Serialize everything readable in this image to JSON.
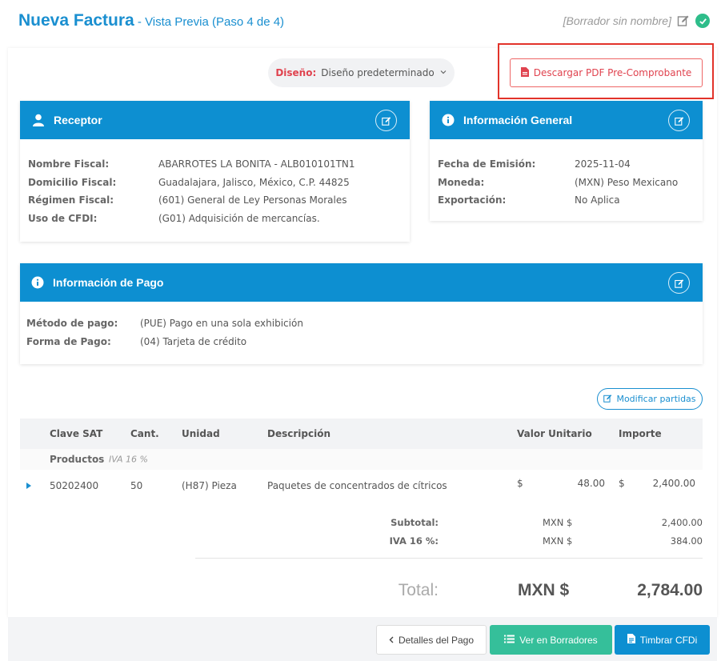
{
  "header": {
    "title": "Nueva Factura",
    "subtitle": " - Vista Previa (Paso 4 de 4)",
    "draft_name": "[Borrador sin nombre]"
  },
  "design": {
    "label": "Diseño:",
    "value": "Diseño predeterminado"
  },
  "pdf_button": {
    "label": "Descargar PDF Pre-Comprobante"
  },
  "receptor": {
    "title": "Receptor",
    "rows": [
      {
        "k": "Nombre Fiscal:",
        "v": "ABARROTES LA BONITA - ALB010101TN1"
      },
      {
        "k": "Domicilio Fiscal:",
        "v": "Guadalajara, Jalisco, México, C.P. 44825"
      },
      {
        "k": "Régimen Fiscal:",
        "v": "(601) General de Ley Personas Morales"
      },
      {
        "k": "Uso de CFDI:",
        "v": "(G01) Adquisición de mercancías."
      }
    ]
  },
  "general": {
    "title": "Información General",
    "rows": [
      {
        "k": "Fecha de Emisión:",
        "v": "2025-11-04"
      },
      {
        "k": "Moneda:",
        "v": "(MXN) Peso Mexicano"
      },
      {
        "k": "Exportación:",
        "v": "No Aplica"
      }
    ]
  },
  "pago": {
    "title": "Información de Pago",
    "rows": [
      {
        "k": "Método de pago:",
        "v": "(PUE) Pago en una sola exhibición"
      },
      {
        "k": "Forma de Pago:",
        "v": "(04) Tarjeta de crédito"
      }
    ]
  },
  "modify_button": {
    "label": "Modificar partidas"
  },
  "table": {
    "headers": [
      "Clave SAT",
      "Cant.",
      "Unidad",
      "Descripción",
      "Valor Unitario",
      "Importe"
    ],
    "group": {
      "name": "Productos",
      "tax": "IVA 16 %"
    },
    "item": {
      "clave": "50202400",
      "cant": "50",
      "unidad": "(H87) Pieza",
      "descripcion": "Paquetes de concentrados de cítricos",
      "vu_currency": "$",
      "vu": "48.00",
      "imp_currency": "$",
      "importe": "2,400.00"
    }
  },
  "totals": {
    "subtotal_label": "Subtotal:",
    "subtotal_currency": "MXN $",
    "subtotal": "2,400.00",
    "iva_label": "IVA 16 %:",
    "iva_currency": "MXN $",
    "iva": "384.00",
    "total_label": "Total:",
    "total_currency": "MXN $",
    "total": "2,784.00"
  },
  "footer": {
    "detalles": "Detalles del Pago",
    "borradores": "Ver en Borradores",
    "timbrar": "Timbrar CFDi"
  },
  "colors": {
    "primary": "#0d8fd1",
    "accent_red": "#e0434f",
    "success": "#2ebd8a"
  }
}
